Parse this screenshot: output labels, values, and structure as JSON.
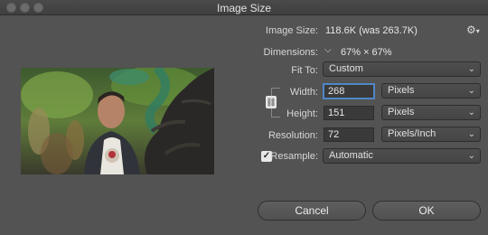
{
  "window": {
    "title": "Image Size"
  },
  "image_size": {
    "label": "Image Size:",
    "value": "118.6K (was 263.7K)"
  },
  "dimensions": {
    "label": "Dimensions:",
    "value": "67% × 67%"
  },
  "fit_to": {
    "label": "Fit To:",
    "value": "Custom"
  },
  "width": {
    "label": "Width:",
    "value": "268",
    "unit": "Pixels"
  },
  "height": {
    "label": "Height:",
    "value": "151",
    "unit": "Pixels"
  },
  "resolution": {
    "label": "Resolution:",
    "value": "72",
    "unit": "Pixels/Inch"
  },
  "resample": {
    "label": "Resample:",
    "checked": true,
    "value": "Automatic"
  },
  "buttons": {
    "cancel": "Cancel",
    "ok": "OK"
  },
  "icons": [
    "gear-icon",
    "link-chain-icon",
    "eye-toggle-icon",
    "chevron-down-icon",
    "checkmark-icon"
  ]
}
